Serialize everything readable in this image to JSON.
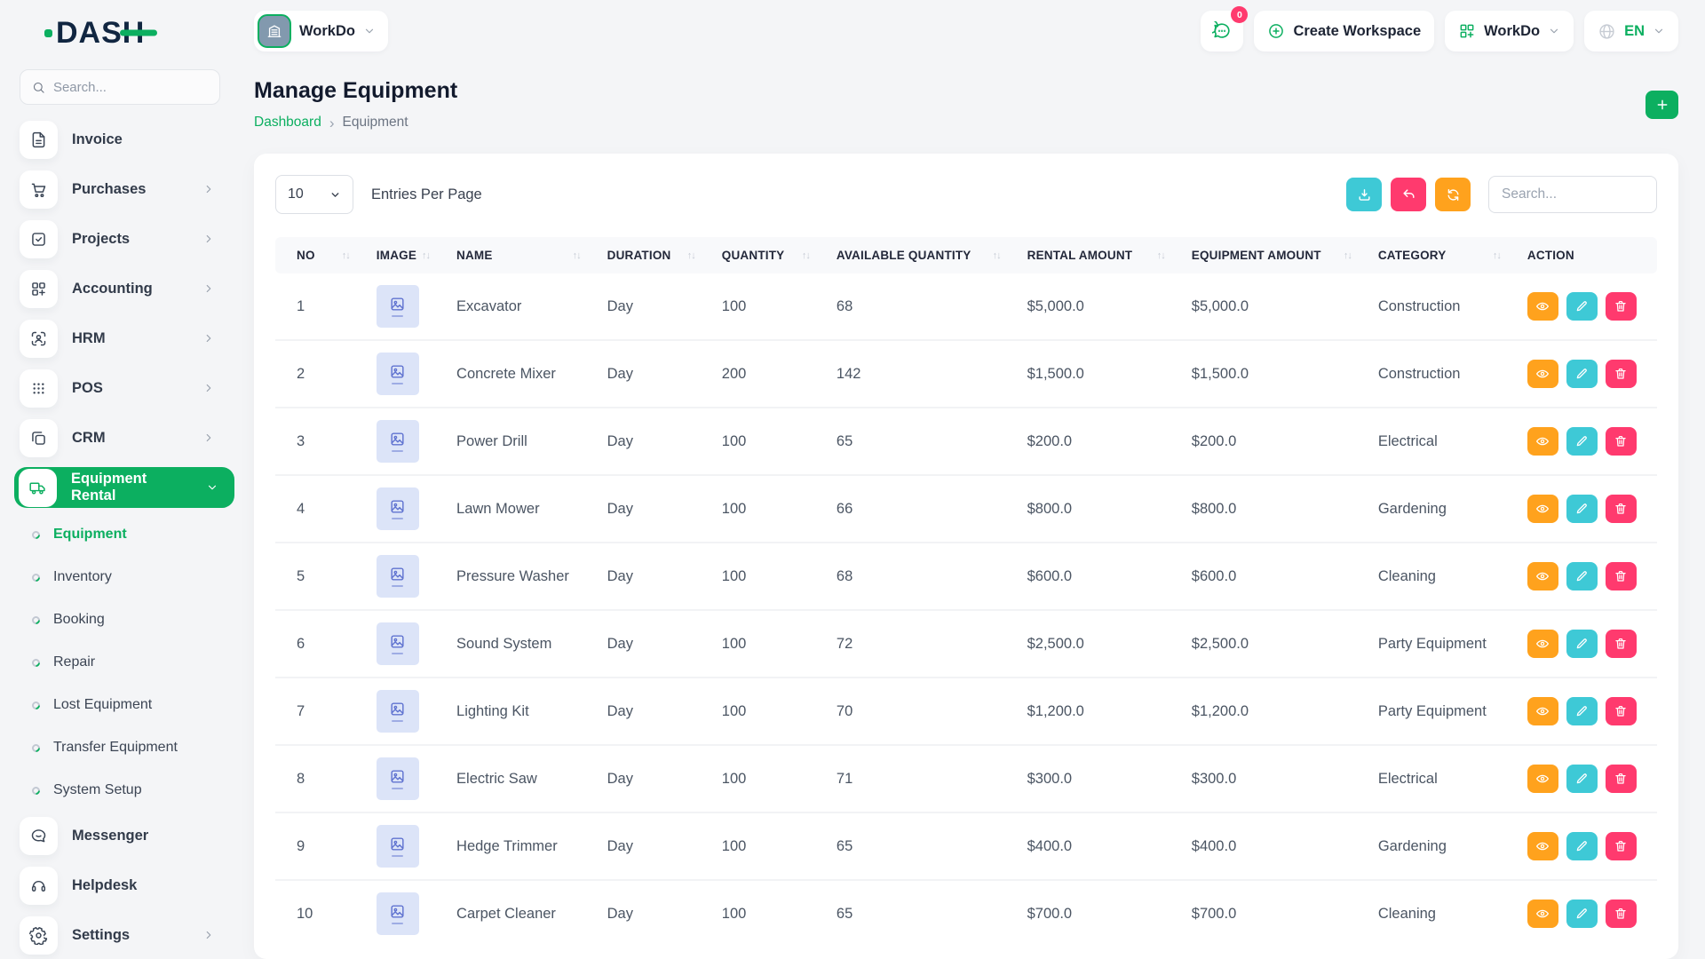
{
  "brand": {
    "name": "DASH"
  },
  "sidebar": {
    "search": {
      "placeholder": "Search..."
    },
    "items": [
      {
        "label": "Invoice"
      },
      {
        "label": "Purchases"
      },
      {
        "label": "Projects"
      },
      {
        "label": "Accounting"
      },
      {
        "label": "HRM"
      },
      {
        "label": "POS"
      },
      {
        "label": "CRM"
      },
      {
        "label": "Equipment Rental"
      }
    ],
    "submenu": [
      {
        "label": "Equipment",
        "active": true
      },
      {
        "label": "Inventory"
      },
      {
        "label": "Booking"
      },
      {
        "label": "Repair"
      },
      {
        "label": "Lost Equipment"
      },
      {
        "label": "Transfer Equipment"
      },
      {
        "label": "System Setup"
      }
    ],
    "bottom_items": [
      {
        "label": "Messenger"
      },
      {
        "label": "Helpdesk"
      },
      {
        "label": "Settings"
      }
    ]
  },
  "topbar": {
    "workspace_label": "WorkDo",
    "messages_badge": "0",
    "create_workspace_label": "Create Workspace",
    "apps_label": "WorkDo",
    "language_label": "EN"
  },
  "page": {
    "title": "Manage Equipment",
    "breadcrumb_home": "Dashboard",
    "breadcrumb_current": "Equipment"
  },
  "toolbar": {
    "entries_value": "10",
    "entries_label": "Entries Per Page",
    "search_placeholder": "Search..."
  },
  "table": {
    "columns": [
      "NO",
      "IMAGE",
      "NAME",
      "DURATION",
      "QUANTITY",
      "AVAILABLE QUANTITY",
      "RENTAL AMOUNT",
      "EQUIPMENT AMOUNT",
      "CATEGORY",
      "ACTION"
    ],
    "rows": [
      {
        "no": "1",
        "name": "Excavator",
        "duration": "Day",
        "quantity": "100",
        "available": "68",
        "rental": "$5,000.0",
        "amount": "$5,000.0",
        "category": "Construction"
      },
      {
        "no": "2",
        "name": "Concrete Mixer",
        "duration": "Day",
        "quantity": "200",
        "available": "142",
        "rental": "$1,500.0",
        "amount": "$1,500.0",
        "category": "Construction"
      },
      {
        "no": "3",
        "name": "Power Drill",
        "duration": "Day",
        "quantity": "100",
        "available": "65",
        "rental": "$200.0",
        "amount": "$200.0",
        "category": "Electrical"
      },
      {
        "no": "4",
        "name": "Lawn Mower",
        "duration": "Day",
        "quantity": "100",
        "available": "66",
        "rental": "$800.0",
        "amount": "$800.0",
        "category": "Gardening"
      },
      {
        "no": "5",
        "name": "Pressure Washer",
        "duration": "Day",
        "quantity": "100",
        "available": "68",
        "rental": "$600.0",
        "amount": "$600.0",
        "category": "Cleaning"
      },
      {
        "no": "6",
        "name": "Sound System",
        "duration": "Day",
        "quantity": "100",
        "available": "72",
        "rental": "$2,500.0",
        "amount": "$2,500.0",
        "category": "Party Equipment"
      },
      {
        "no": "7",
        "name": "Lighting Kit",
        "duration": "Day",
        "quantity": "100",
        "available": "70",
        "rental": "$1,200.0",
        "amount": "$1,200.0",
        "category": "Party Equipment"
      },
      {
        "no": "8",
        "name": "Electric Saw",
        "duration": "Day",
        "quantity": "100",
        "available": "71",
        "rental": "$300.0",
        "amount": "$300.0",
        "category": "Electrical"
      },
      {
        "no": "9",
        "name": "Hedge Trimmer",
        "duration": "Day",
        "quantity": "100",
        "available": "65",
        "rental": "$400.0",
        "amount": "$400.0",
        "category": "Gardening"
      },
      {
        "no": "10",
        "name": "Carpet Cleaner",
        "duration": "Day",
        "quantity": "100",
        "available": "65",
        "rental": "$700.0",
        "amount": "$700.0",
        "category": "Cleaning"
      }
    ]
  },
  "colors": {
    "primary_green": "#0CAF60",
    "info_cyan": "#3EC9D6",
    "danger_pink": "#FF3A6E",
    "warning_orange": "#FFA21D",
    "image_placeholder_bg": "#DCE4F8"
  }
}
